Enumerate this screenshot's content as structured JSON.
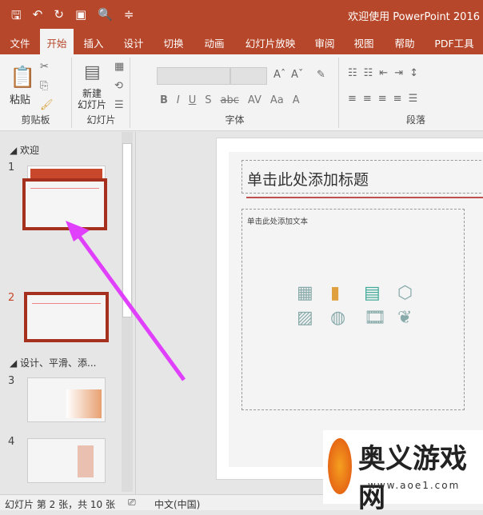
{
  "titlebar": {
    "title": "欢迎使用 PowerPoint 2016",
    "qat": [
      {
        "icon": "save-icon",
        "glyph": "🖫"
      },
      {
        "icon": "undo-icon",
        "glyph": "↶"
      },
      {
        "icon": "redo-icon",
        "glyph": "↻"
      },
      {
        "icon": "slideshow-icon",
        "glyph": "▣"
      },
      {
        "icon": "preview-icon",
        "glyph": "🔍"
      },
      {
        "icon": "customize-icon",
        "glyph": "≑"
      }
    ]
  },
  "tabs": [
    "文件",
    "开始",
    "插入",
    "设计",
    "切换",
    "动画",
    "幻灯片放映",
    "审阅",
    "视图",
    "帮助",
    "PDF工具"
  ],
  "ribbon": {
    "clipboard": {
      "label": "剪贴板",
      "paste": "粘贴"
    },
    "slides": {
      "label": "幻灯片",
      "new_slide": "新建\n幻灯片"
    },
    "font": {
      "label": "字体",
      "buttons": [
        "B",
        "I",
        "U",
        "S",
        "abc",
        "AV",
        "Aa",
        "A"
      ]
    },
    "paragraph": {
      "label": "段落"
    }
  },
  "panel": {
    "sections": [
      "欢迎",
      "设计、平滑、添..."
    ],
    "slide_numbers": [
      "1",
      "2",
      "3",
      "4"
    ]
  },
  "slide": {
    "title_placeholder": "单击此处添加标题",
    "content_placeholder": "单击此处添加文本",
    "insert_icons": [
      "table-icon",
      "chart-icon",
      "smartart-icon",
      "3d-model-icon",
      "picture-icon",
      "online-picture-icon",
      "video-icon",
      "icon-insert-icon"
    ]
  },
  "status": {
    "slide_info": "幻灯片 第 2 张，共 10 张",
    "language": "中文(中国)"
  },
  "watermark": {
    "name": "奥义游戏网",
    "url": "www.aoe1.com"
  },
  "colors": {
    "accent": "#b7472a",
    "annotation_arrow": "#e040fb"
  }
}
